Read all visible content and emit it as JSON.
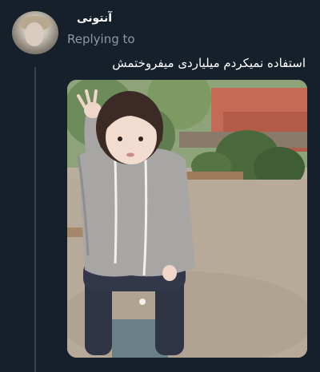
{
  "tweet": {
    "author_name": "آنتونی",
    "replying_to": "Replying to",
    "text": "استفاده نمیکردم میلیاردی میفروختمش"
  },
  "media": {
    "icon": "photo-meme-child-saluting"
  },
  "colors": {
    "background": "#15202b",
    "primary_text": "#ffffff",
    "secondary_text": "#8b98a5",
    "thread_line": "#38444d"
  }
}
